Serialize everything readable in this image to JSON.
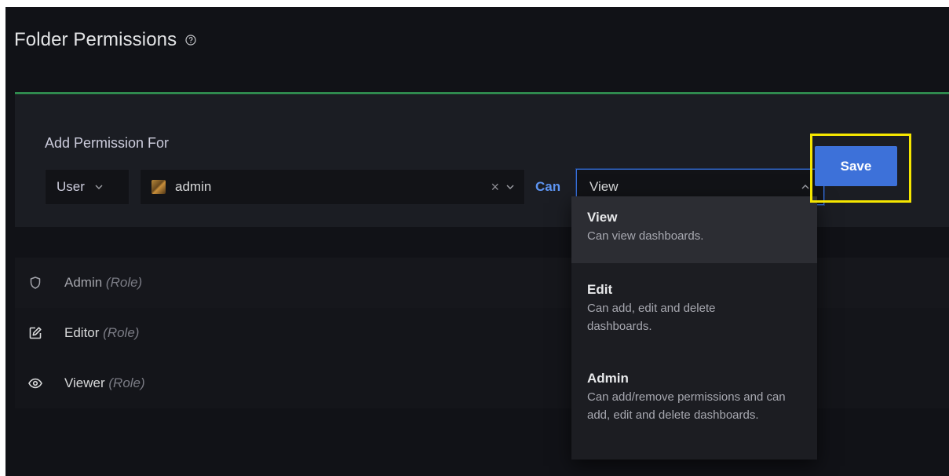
{
  "header": {
    "title": "Folder Permissions"
  },
  "add_permission": {
    "label": "Add Permission For",
    "type_value": "User",
    "user_value": "admin",
    "can_label": "Can",
    "permission_value": "View",
    "save_label": "Save"
  },
  "dropdown": {
    "options": [
      {
        "title": "View",
        "desc": "Can view dashboards."
      },
      {
        "title": "Edit",
        "desc": "Can add, edit and delete dashboards."
      },
      {
        "title": "Admin",
        "desc": "Can add/remove permissions and can add, edit and delete dashboards."
      }
    ]
  },
  "permissions": [
    {
      "name": "Admin",
      "role": "(Role)",
      "icon": "shield-icon"
    },
    {
      "name": "Editor",
      "role": "(Role)",
      "icon": "edit-icon"
    },
    {
      "name": "Viewer",
      "role": "(Role)",
      "icon": "eye-icon"
    }
  ],
  "colors": {
    "accent_green": "#2f8a4e",
    "primary_blue": "#3d71d9",
    "highlight_yellow": "#f5e600"
  }
}
